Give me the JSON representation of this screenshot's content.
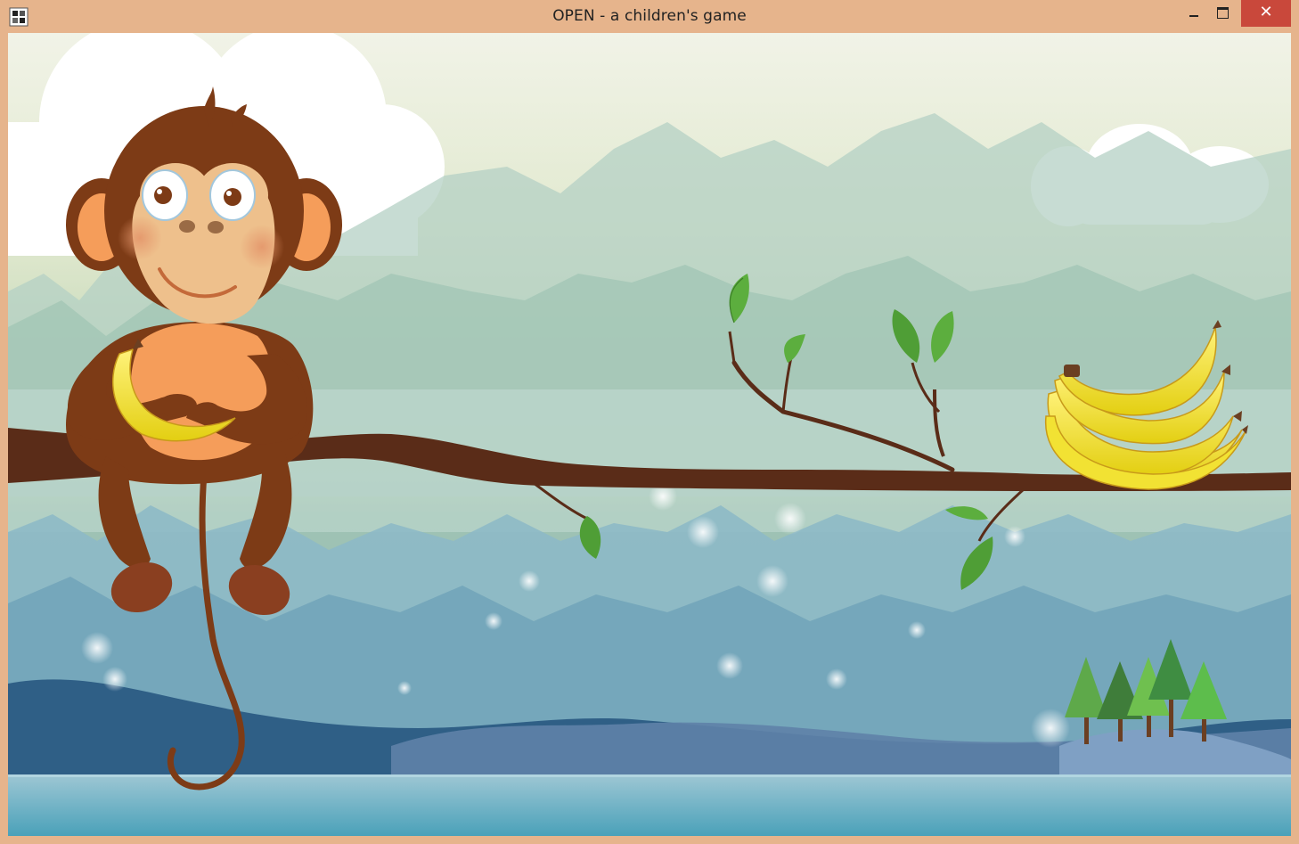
{
  "window": {
    "title": "OPEN - a children's game",
    "close_glyph": "✕",
    "border_color": "#e6b48c",
    "close_color": "#c9483b"
  },
  "scene": {
    "characters": [
      "monkey-holding-banana"
    ],
    "items": [
      "banana-bunch"
    ],
    "decor": [
      "tree-branch",
      "leaves",
      "clouds",
      "mountains",
      "pine-trees",
      "water",
      "sparkles"
    ]
  }
}
